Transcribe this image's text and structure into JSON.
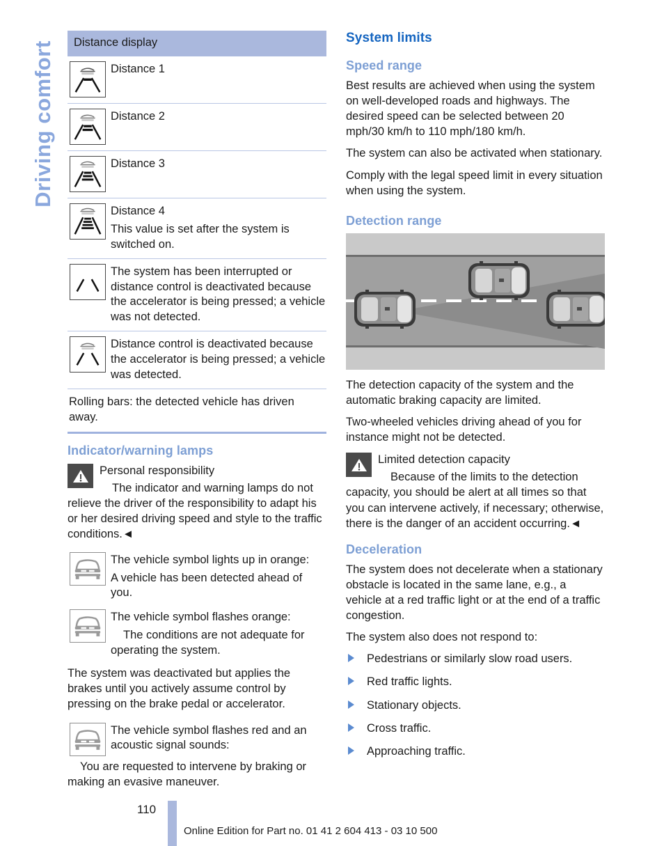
{
  "chapter_tab": "Driving comfort",
  "left_column": {
    "table": {
      "header": "Distance display",
      "rows": [
        {
          "icon": "distance-1-icon",
          "bars": 1,
          "lines": [
            "Distance 1"
          ]
        },
        {
          "icon": "distance-2-icon",
          "bars": 2,
          "lines": [
            "Distance 2"
          ]
        },
        {
          "icon": "distance-3-icon",
          "bars": 3,
          "lines": [
            "Distance 3"
          ]
        },
        {
          "icon": "distance-4-icon",
          "bars": 4,
          "lines": [
            "Distance 4",
            "This value is set after the system is switched on."
          ]
        },
        {
          "icon": "system-interrupted-icon",
          "bars": 0,
          "car": false,
          "lines": [
            "The system has been interrupted or distance control is deactivated because the accelerator is being pressed; a vehicle was not detected."
          ]
        },
        {
          "icon": "distance-control-deactivated-icon",
          "bars": 0,
          "car": true,
          "lines": [
            "Distance control is deactivated because the accelerator is being pressed; a vehicle was detected."
          ]
        }
      ],
      "note": "Rolling bars: the detected vehicle has driven away."
    },
    "lamps_heading": "Indicator/warning lamps",
    "warning": {
      "icon": "warning-triangle-icon",
      "title": "Personal responsibility",
      "text": "The indicator and warning lamps do not relieve the driver of the responsibility to adapt his or her desired driving speed and style to the traffic conditions.◄"
    },
    "lamp_rows": [
      {
        "icon": "vehicle-symbol-icon",
        "lines": [
          "The vehicle symbol lights up in orange:",
          "A vehicle has been detected ahead of you."
        ]
      },
      {
        "icon": "vehicle-symbol-icon",
        "lines": [
          "The vehicle symbol flashes orange:",
          "The conditions are not adequate for operating the system."
        ]
      }
    ],
    "deactivated_paragraph": "The system was deactivated but applies the brakes until you actively assume control by pressing on the brake pedal or accelerator.",
    "lamp_rows_2": [
      {
        "icon": "vehicle-symbol-icon",
        "lines": [
          "The vehicle symbol flashes red and an acoustic signal sounds:",
          "You are requested to intervene by braking or making an evasive maneuver."
        ]
      }
    ]
  },
  "right_column": {
    "section_heading": "System limits",
    "speed_range": {
      "heading": "Speed range",
      "paragraphs": [
        "Best results are achieved when using the system on well-developed roads and highways. The desired speed can be selected between 20 mph/30 km/h to 110 mph/180 km/h.",
        "The system can also be activated when stationary.",
        "Comply with the legal speed limit in every situation when using the system."
      ]
    },
    "detection_range": {
      "heading": "Detection range",
      "figure_name": "detection-range-diagram",
      "paragraphs": [
        "The detection capacity of the system and the automatic braking capacity are limited.",
        "Two-wheeled vehicles driving ahead of you for instance might not be detected."
      ],
      "warning": {
        "icon": "warning-triangle-icon",
        "title": "Limited detection capacity",
        "text": "Because of the limits to the detection capacity, you should be alert at all times so that you can intervene actively, if necessary; otherwise, there is the danger of an accident occurring.◄"
      }
    },
    "deceleration": {
      "heading": "Deceleration",
      "paragraphs": [
        "The system does not decelerate when a stationary obstacle is located in the same lane, e.g., a vehicle at a red traffic light or at the end of a traffic congestion.",
        "The system also does not respond to:"
      ],
      "items": [
        "Pedestrians or similarly slow road users.",
        "Red traffic lights.",
        "Stationary objects.",
        "Cross traffic.",
        "Approaching traffic."
      ]
    }
  },
  "footer": {
    "page_number": "110",
    "copy": "Online Edition for Part no. 01 41 2 604 413 - 03 10 500"
  },
  "colors": {
    "accent_strong": "#1565c0",
    "accent_light": "#7d9fd4",
    "table_header_bg": "#aab8dd",
    "tab_color": "#8aa7dd"
  }
}
